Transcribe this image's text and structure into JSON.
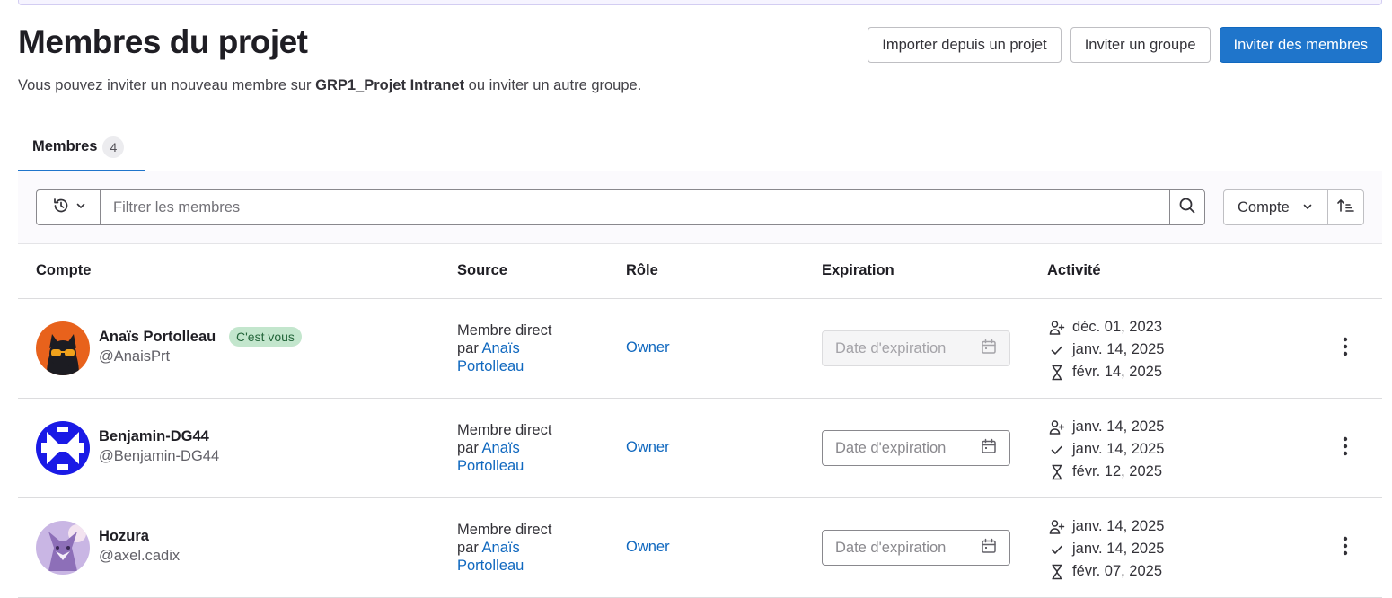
{
  "header": {
    "title": "Membres du projet",
    "subtitle_prefix": "Vous pouvez inviter un nouveau membre sur ",
    "project_name": "GRP1_Projet Intranet",
    "subtitle_suffix": " ou inviter un autre groupe.",
    "actions": {
      "import": "Importer depuis un projet",
      "invite_group": "Inviter un groupe",
      "invite_members": "Inviter des membres"
    }
  },
  "tabs": [
    {
      "label": "Membres",
      "count": "4"
    }
  ],
  "filter": {
    "placeholder": "Filtrer les membres",
    "sort_label": "Compte",
    "icons": {
      "history": "history-icon",
      "search": "search-icon",
      "sort_direction": "sort-ascending-icon"
    }
  },
  "table": {
    "columns": [
      "Compte",
      "Source",
      "Rôle",
      "Expiration",
      "Activité"
    ],
    "rows": [
      {
        "name": "Anaïs Portolleau",
        "badge": "C'est vous",
        "handle": "@AnaisPrt",
        "source_line1": "Membre direct",
        "source_par": "par ",
        "source_by_1": "Anaïs",
        "source_by_2": "Portolleau",
        "role": "Owner",
        "expiration_placeholder": "Date d'expiration",
        "activity": {
          "created": "déc. 01, 2023",
          "last_activity": "janv. 14, 2025",
          "expires": "févr. 14, 2025"
        }
      },
      {
        "name": "Benjamin-DG44",
        "badge": "",
        "handle": "@Benjamin-DG44",
        "source_line1": "Membre direct",
        "source_par": "par ",
        "source_by_1": "Anaïs",
        "source_by_2": "Portolleau",
        "role": "Owner",
        "expiration_placeholder": "Date d'expiration",
        "activity": {
          "created": "janv. 14, 2025",
          "last_activity": "janv. 14, 2025",
          "expires": "févr. 12, 2025"
        }
      },
      {
        "name": "Hozura",
        "badge": "",
        "handle": "@axel.cadix",
        "source_line1": "Membre direct",
        "source_par": "par ",
        "source_by_1": "Anaïs",
        "source_by_2": "Portolleau",
        "role": "Owner",
        "expiration_placeholder": "Date d'expiration",
        "activity": {
          "created": "janv. 14, 2025",
          "last_activity": "janv. 14, 2025",
          "expires": "févr. 07, 2025"
        }
      }
    ]
  },
  "colors": {
    "primary": "#1f75cb",
    "link": "#1068bf",
    "badge_green_bg": "#c3e6cd",
    "badge_green_text": "#24663b"
  }
}
